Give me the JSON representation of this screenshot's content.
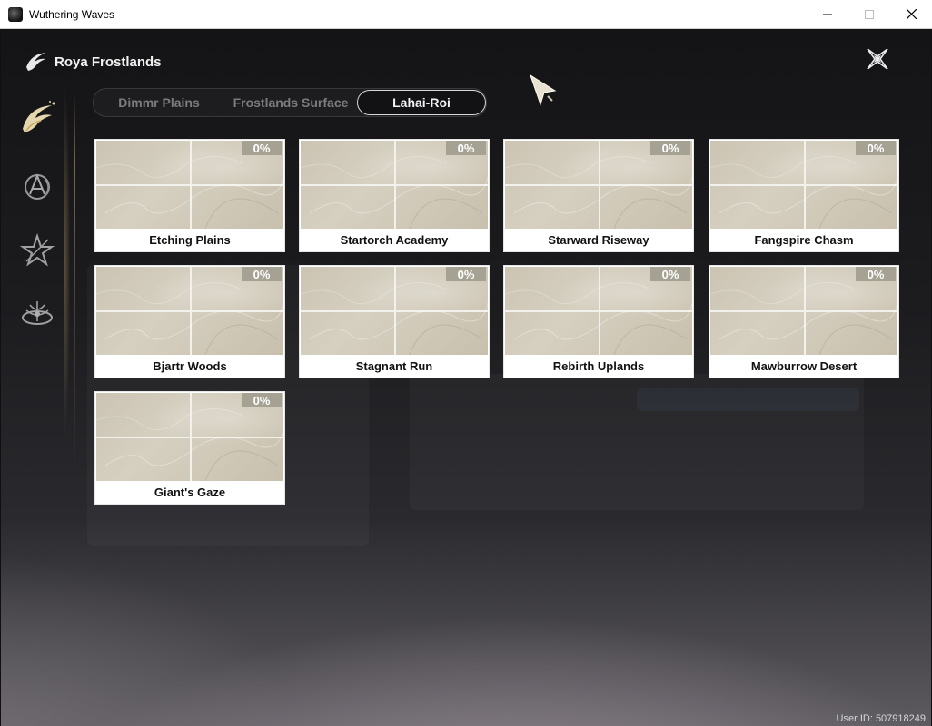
{
  "window": {
    "title": "Wuthering Waves"
  },
  "header": {
    "title": "Roya Frostlands"
  },
  "tabs": [
    {
      "label": "Dimmr Plains",
      "active": false
    },
    {
      "label": "Frostlands Surface",
      "active": false
    },
    {
      "label": "Lahai-Roi",
      "active": true
    }
  ],
  "regions": [
    {
      "name": "Etching Plains",
      "progress": "0%"
    },
    {
      "name": "Startorch Academy",
      "progress": "0%"
    },
    {
      "name": "Starward Riseway",
      "progress": "0%"
    },
    {
      "name": "Fangspire Chasm",
      "progress": "0%"
    },
    {
      "name": "Bjartr Woods",
      "progress": "0%"
    },
    {
      "name": "Stagnant Run",
      "progress": "0%"
    },
    {
      "name": "Rebirth Uplands",
      "progress": "0%"
    },
    {
      "name": "Mawburrow Desert",
      "progress": "0%"
    },
    {
      "name": "Giant's Gaze",
      "progress": "0%"
    }
  ],
  "footer": {
    "user_id": "User ID: 507918249"
  }
}
